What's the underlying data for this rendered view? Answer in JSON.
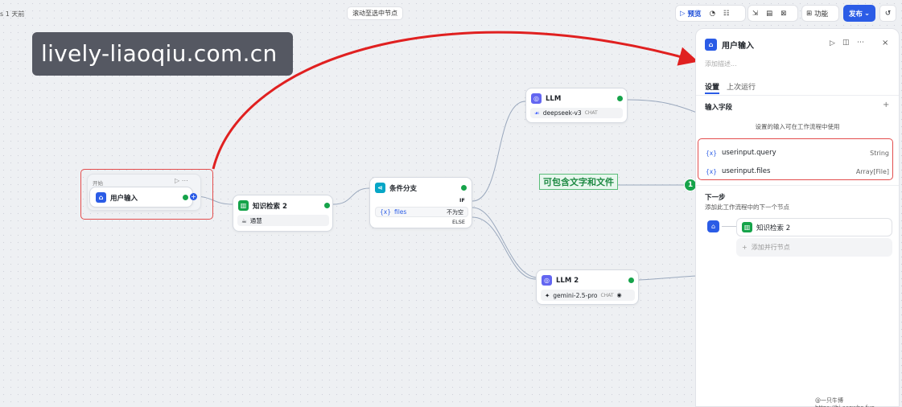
{
  "topbar": {
    "left_text": "s 1 天前",
    "scroll_button": "滚动至选中节点",
    "preview_label": "预览",
    "features_label": "功能",
    "publish_label": "发布"
  },
  "watermark": "lively-liaoqiu.com.cn",
  "canvas": {
    "start_node": {
      "group_label": "开始",
      "title": "用户输入"
    },
    "knowledge_node": {
      "title": "知识检索 2",
      "sub": "通慧"
    },
    "condition_node": {
      "title": "条件分支",
      "if_label": "IF",
      "var_name": "files",
      "op": "不为空",
      "else_label": "ELSE"
    },
    "llm_node": {
      "title": "LLM",
      "model": "deepseek-v3",
      "tag": "CHAT"
    },
    "llm2_node": {
      "title": "LLM 2",
      "model": "gemini-2.5-pro",
      "tag": "CHAT"
    },
    "annotation": "可包含文字和文件",
    "badge": "1"
  },
  "panel": {
    "title": "用户输入",
    "desc_placeholder": "添加描述...",
    "tabs": [
      "设置",
      "上次运行"
    ],
    "input_fields_label": "输入字段",
    "input_hint": "设置的输入可在工作流程中使用",
    "fields": [
      {
        "name": "userinput.query",
        "type": "String"
      },
      {
        "name": "userinput.files",
        "type": "Array[File]"
      }
    ],
    "next_step_title": "下一步",
    "next_step_desc": "添加此工作流程中的下一个节点",
    "next_node": "知识检索 2",
    "add_parallel": "添加并行节点"
  },
  "footer": "@一只牛博https://hi.acowbo.fun",
  "colors": {
    "accent": "#2b5ce6",
    "success": "#16a34a",
    "annotation_red": "#e02020"
  }
}
